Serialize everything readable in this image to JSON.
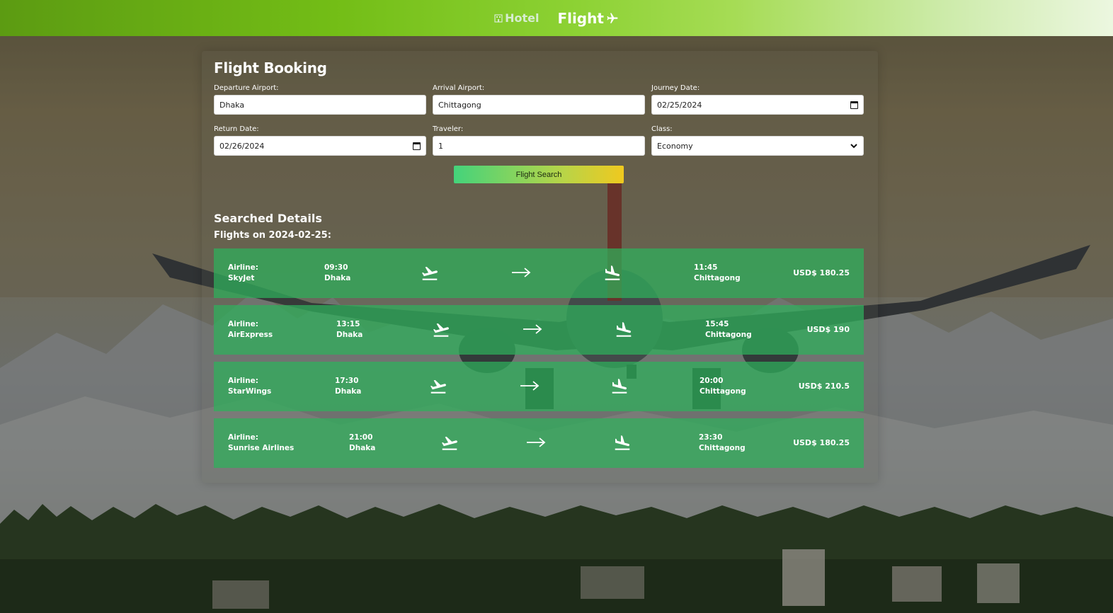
{
  "nav": {
    "hotel_label": "Hotel",
    "flight_label": "Flight",
    "hotel_icon": "hotel-building-icon",
    "flight_icon": "airplane-icon"
  },
  "form": {
    "title": "Flight Booking",
    "departure": {
      "label": "Departure Airport:",
      "value": "Dhaka"
    },
    "arrival": {
      "label": "Arrival Airport:",
      "value": "Chittagong"
    },
    "journey_date": {
      "label": "Journey Date:",
      "value": "02/25/2024"
    },
    "return_date": {
      "label": "Return Date:",
      "value": "02/26/2024"
    },
    "traveler": {
      "label": "Traveler:",
      "value": "1"
    },
    "class": {
      "label": "Class:",
      "value": "Economy"
    },
    "search_button": "Flight Search"
  },
  "results": {
    "title": "Searched Details",
    "subtitle": "Flights on 2024-02-25:",
    "airline_label": "Airline:",
    "flights": [
      {
        "airline": "SkyJet",
        "dep_time": "09:30",
        "dep_city": "Dhaka",
        "arr_time": "11:45",
        "arr_city": "Chittagong",
        "price": "USD$ 180.25"
      },
      {
        "airline": "AirExpress",
        "dep_time": "13:15",
        "dep_city": "Dhaka",
        "arr_time": "15:45",
        "arr_city": "Chittagong",
        "price": "USD$ 190"
      },
      {
        "airline": "StarWings",
        "dep_time": "17:30",
        "dep_city": "Dhaka",
        "arr_time": "20:00",
        "arr_city": "Chittagong",
        "price": "USD$ 210.5"
      },
      {
        "airline": "Sunrise Airlines",
        "dep_time": "21:00",
        "dep_city": "Dhaka",
        "arr_time": "23:30",
        "arr_city": "Chittagong",
        "price": "USD$ 180.25"
      }
    ]
  },
  "colors": {
    "nav_start": "#5c9b12",
    "nav_end": "#ecf7e0",
    "card": "#2eb25c",
    "button_start": "#44d37b",
    "button_end": "#f0c91f"
  }
}
